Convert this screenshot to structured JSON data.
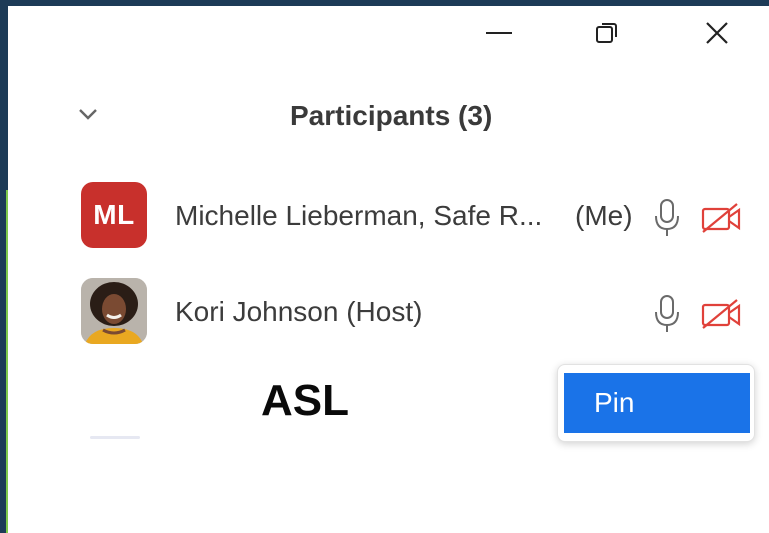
{
  "window_controls": {
    "minimize": "minimize-icon",
    "restore": "restore-icon",
    "close": "close-icon"
  },
  "panel": {
    "collapse_icon": "chevron-down-icon",
    "title": "Participants (3)"
  },
  "participants": [
    {
      "avatar_initials": "ML",
      "avatar_color": "#c8302c",
      "name": "Michelle Lieberman, Safe R...",
      "me_label": "(Me)",
      "mic_icon": "microphone-icon",
      "video_icon": "video-off-icon"
    },
    {
      "avatar_type": "photo",
      "name": "Kori Johnson (Host)",
      "mic_icon": "microphone-icon",
      "video_icon": "video-off-icon"
    }
  ],
  "group_label": "ASL",
  "context_menu": {
    "items": [
      {
        "label": "Pin"
      }
    ]
  },
  "colors": {
    "accent": "#1a73e8",
    "video_off": "#e0413a",
    "icon_gray": "#6a6a6a",
    "title_text": "#3a3a3a",
    "background_window": "#1d3b57"
  }
}
